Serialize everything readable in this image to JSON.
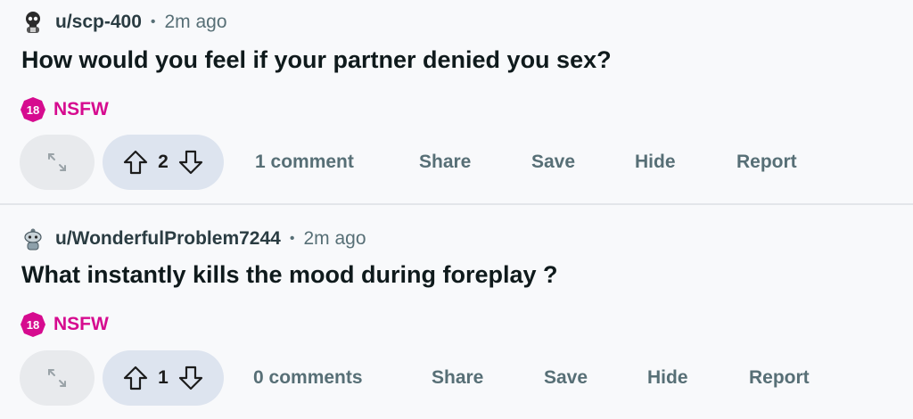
{
  "posts": [
    {
      "username": "u/scp-400",
      "separator": "•",
      "time": "2m ago",
      "title": "How would you feel if your partner denied you sex?",
      "nsfw_badge": "18",
      "nsfw_label": "NSFW",
      "votes": "2",
      "comments": "1 comment",
      "share": "Share",
      "save": "Save",
      "hide": "Hide",
      "report": "Report",
      "avatar_icon": "skull-avatar-icon"
    },
    {
      "username": "u/WonderfulProblem7244",
      "separator": "•",
      "time": "2m ago",
      "title": "What instantly kills the mood during foreplay ?",
      "nsfw_badge": "18",
      "nsfw_label": "NSFW",
      "votes": "1",
      "comments": "0 comments",
      "share": "Share",
      "save": "Save",
      "hide": "Hide",
      "report": "Report",
      "avatar_icon": "snoo-avatar-icon"
    }
  ],
  "colors": {
    "nsfw": "#d60b8f",
    "vote_pill": "#dde4ef",
    "muted_text": "#576f76"
  }
}
